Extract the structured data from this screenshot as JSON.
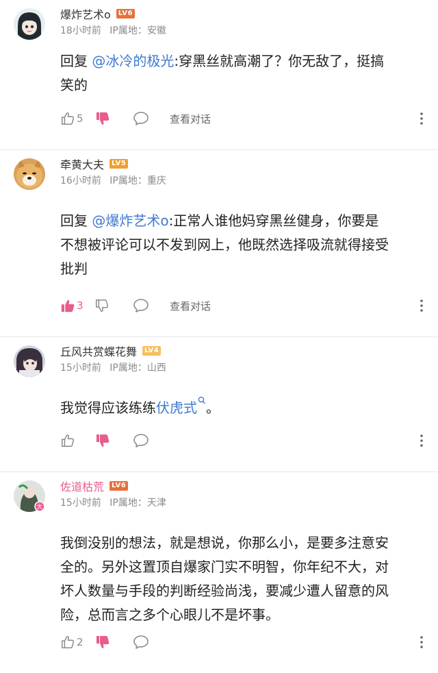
{
  "comments": [
    {
      "username": "爆炸艺术o",
      "level": "LV6",
      "level_color": "#e8703a",
      "time": "18小时前",
      "ip": "IP属地：安徽",
      "reply_prefix": "回复",
      "mention": "@冰冷的极光",
      "text_line1": ":穿黑丝就高潮了？你无敌了，挺搞",
      "text_line2": "笑的",
      "likes": "5",
      "liked": false,
      "disliked": true,
      "view_label": "查看对话"
    },
    {
      "username": "牵黄大夫",
      "level": "LV5",
      "level_color": "#f0a030",
      "time": "16小时前",
      "ip": "IP属地：重庆",
      "reply_prefix": "回复",
      "mention": "@爆炸艺术o",
      "text_line1": ":正常人谁他妈穿黑丝健身，你要是",
      "text_line2": "不想被评论可以不发到网上，他既然选择吸流就得接受",
      "text_line3": "批判",
      "likes": "3",
      "liked": true,
      "disliked": false,
      "view_label": "查看对话"
    },
    {
      "username": "丘风共赏蝶花舞",
      "level": "LV4",
      "level_color": "#f5c060",
      "time": "15小时前",
      "ip": "IP属地：山西",
      "text_before": "我觉得应该练练",
      "link": "伏虎式",
      "text_after": "。",
      "liked": false,
      "disliked": true
    },
    {
      "username": "佐道枯荒",
      "level": "LV6",
      "level_color": "#e8703a",
      "time": "15小时前",
      "ip": "IP属地：天津",
      "lines": [
        "我倒没别的想法，就是想说，你那么小，是要多注意安",
        "全的。另外这置顶自爆家门实不明智，你年纪不大，对",
        "坏人数量与手段的判断经验尚浅，要减少遭人留意的风",
        "险，总而言之多个心眼儿不是坏事。"
      ],
      "likes": "2",
      "liked": false,
      "disliked": true
    }
  ],
  "colors": {
    "accent_pink": "#e85c8e",
    "mention_blue": "#3e7ad1",
    "vip_badge": "#e85c8e"
  },
  "icons": [
    "thumbs-up-icon",
    "thumbs-down-icon",
    "comment-bubble-icon",
    "more-vertical-icon",
    "search-icon"
  ]
}
